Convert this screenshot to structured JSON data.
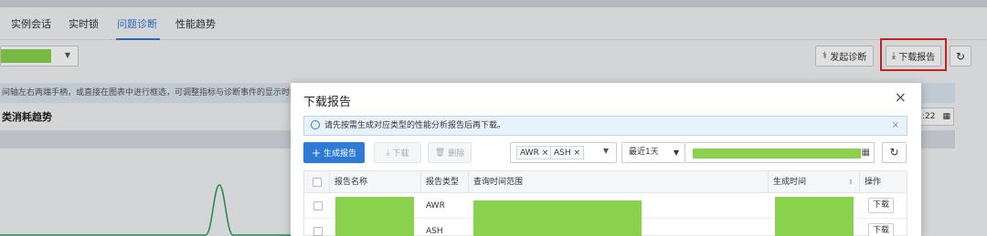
{
  "tabs": [
    {
      "label": "实例会话"
    },
    {
      "label": "实时锁"
    },
    {
      "label": "问题诊断",
      "active": true
    },
    {
      "label": "性能趋势"
    }
  ],
  "toolbar": {
    "diagnose_label": "发起诊断",
    "download_label": "下载报告"
  },
  "info_text": "间轴左右两端手柄，或直接在图表中进行框选，可调整指标与诊断事件的显示时间范",
  "trend_title": "类消耗趋势",
  "time_value": ":22",
  "modal": {
    "title": "下载报告",
    "tip": "请先按需生成对应类型的性能分析报告后再下载。",
    "generate_label": "生成报告",
    "download_label": "下载",
    "delete_label": "删除",
    "type_tags": [
      "AWR",
      "ASH"
    ],
    "range_label": "最近1天",
    "columns": [
      "报告名称",
      "报告类型",
      "查询时间范围",
      "生成时间",
      "操作"
    ],
    "rows": [
      {
        "type": "AWR",
        "action": "下载"
      },
      {
        "type": "ASH",
        "action": "下载"
      }
    ]
  },
  "colors": {
    "accent": "#2e7bd6",
    "redacted": "#8ad24e",
    "highlight": "#e0271e",
    "chart_line": "#2a9d57"
  }
}
